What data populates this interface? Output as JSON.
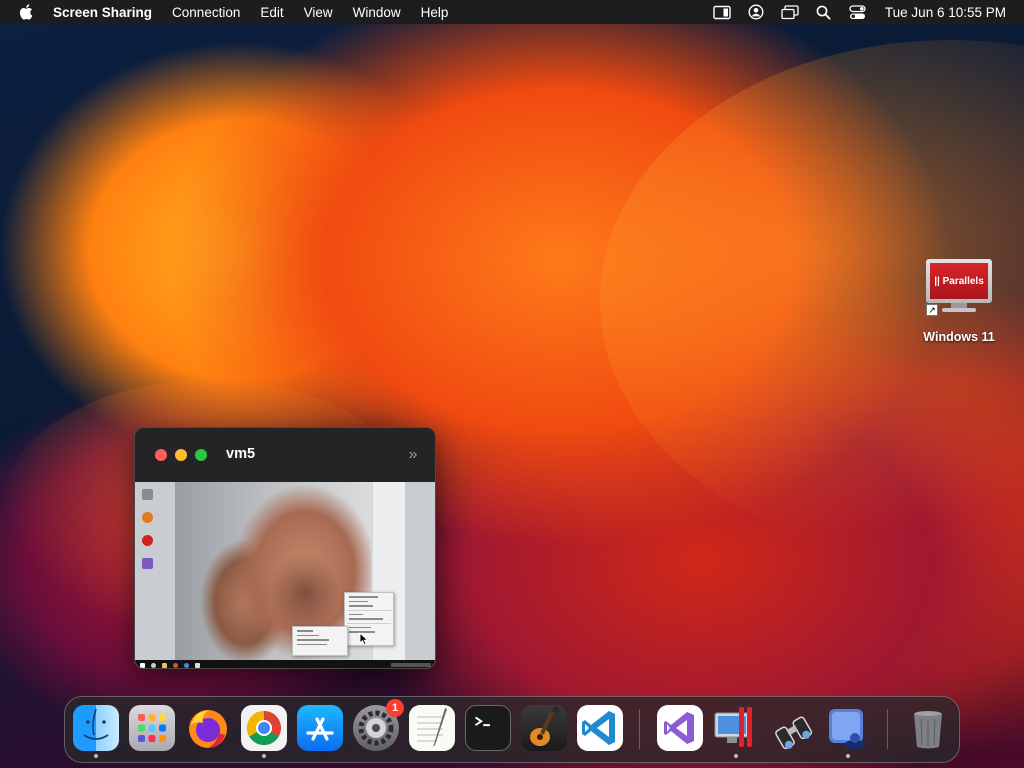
{
  "menubar": {
    "app_name": "Screen Sharing",
    "menus": [
      "Connection",
      "Edit",
      "View",
      "Window",
      "Help"
    ],
    "clock": "Tue Jun 6  10:55 PM",
    "status_icons": [
      "stage-manager-icon",
      "user-account-icon",
      "screen-mirroring-icon",
      "spotlight-search-icon",
      "control-center-icon"
    ]
  },
  "desktop": {
    "icons": [
      {
        "label": "Windows 11",
        "logo_text": "|| Parallels",
        "icon": "parallels-vm-alias-icon"
      }
    ]
  },
  "window": {
    "title": "vm5",
    "buttons": [
      "close",
      "minimize",
      "zoom"
    ],
    "overflow_glyph": "»",
    "content": "remote-desktop-view"
  },
  "dock": {
    "apps": [
      {
        "name": "Finder",
        "icon": "finder-icon",
        "running": true
      },
      {
        "name": "Launchpad",
        "icon": "launchpad-icon",
        "running": false
      },
      {
        "name": "Firefox",
        "icon": "firefox-icon",
        "running": false
      },
      {
        "name": "Chrome",
        "icon": "chrome-icon",
        "running": true
      },
      {
        "name": "App Store",
        "icon": "app-store-icon",
        "running": false
      },
      {
        "name": "System Settings",
        "icon": "system-settings-icon",
        "running": false,
        "badge": "1"
      },
      {
        "name": "TextEdit",
        "icon": "textedit-icon",
        "running": false
      },
      {
        "name": "Terminal",
        "icon": "terminal-icon",
        "running": false
      },
      {
        "name": "GarageBand",
        "icon": "garageband-icon",
        "running": false
      },
      {
        "name": "Visual Studio Code",
        "icon": "vscode-icon",
        "running": false
      },
      {
        "name": "Visual Studio",
        "icon": "visual-studio-icon",
        "running": false
      },
      {
        "name": "Parallels Desktop",
        "icon": "parallels-desktop-icon",
        "running": true
      },
      {
        "name": "Screen Sharing",
        "icon": "screen-sharing-binoculars-icon",
        "running": false
      },
      {
        "name": "Preview",
        "icon": "preview-icon",
        "running": true
      },
      {
        "name": "Trash",
        "icon": "trash-icon",
        "running": false
      }
    ]
  },
  "colors": {
    "menubar_bg": "#1d1d1f",
    "traffic_close": "#ff5f57",
    "traffic_min": "#febc2e",
    "traffic_max": "#28c840",
    "badge": "#ff3b30"
  }
}
